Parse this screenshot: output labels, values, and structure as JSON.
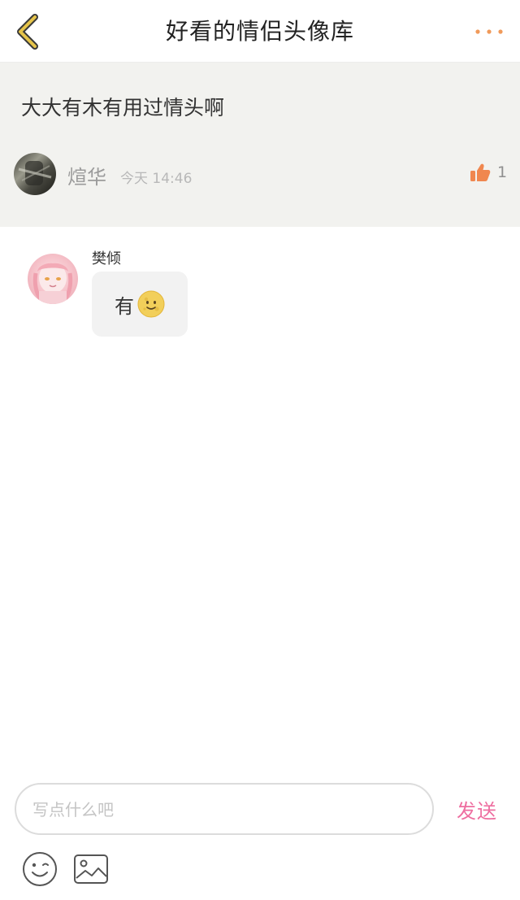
{
  "header": {
    "title": "好看的情侣头像库",
    "back_icon": "chevron-left-icon",
    "more_icon": "more-dots-icon",
    "accent_color": "#e6c44a",
    "more_color": "#f09a5a"
  },
  "post": {
    "text": "大大有木有用过情头啊",
    "author": "煊华",
    "time": "今天 14:46",
    "like_icon": "thumbs-up-icon",
    "like_count": "1",
    "like_color": "#f0874f"
  },
  "reply": {
    "name": "樊倾",
    "message": "有",
    "emoji_icon": "smiling-moon-emoji"
  },
  "composer": {
    "placeholder": "写点什么吧",
    "send_label": "发送",
    "send_color": "#ee6ea0",
    "emoji_button_icon": "smiley-face-icon",
    "image_button_icon": "image-icon"
  }
}
